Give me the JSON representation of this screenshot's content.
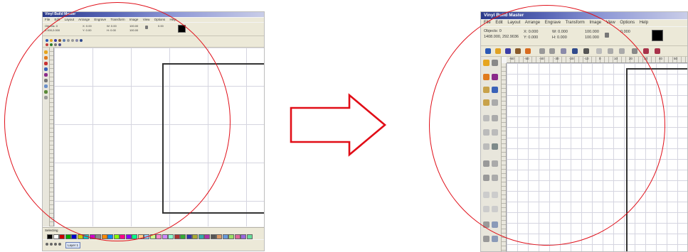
{
  "left_screen": {
    "window_title": "Vinyl Build Master",
    "menu": [
      "File",
      "Edit",
      "Layout",
      "Arrange",
      "Engrave",
      "Transform",
      "Image",
      "View",
      "Options",
      "Help"
    ],
    "prop_objects": "Objects: 0",
    "prop_coords": "0.000,0.000",
    "prop_x": "X: 0.00",
    "prop_y": "Y: 0.00",
    "prop_w": "W: 0.00",
    "prop_h": "H: 0.00",
    "prop_sw": "100.00",
    "prop_sh": "100.00",
    "prop_rot": "0.00",
    "status_text": "Selecting",
    "layer_tab": "Layer 1"
  },
  "right_screen": {
    "window_title": "Vinyl Build Master",
    "menu": [
      "File",
      "Edit",
      "Layout",
      "Arrange",
      "Engrave",
      "Transform",
      "Image",
      "View",
      "Options",
      "Help"
    ],
    "prop_objects": "Objects: 0",
    "prop_coords": "1408.000, 292.9036",
    "prop_x": "X: 0.000",
    "prop_y": "Y: 0.000",
    "prop_w": "W: 0.000",
    "prop_h": "H: 0.000",
    "prop_sw": "100.000",
    "prop_sh": "100.000",
    "prop_rot": "0.000",
    "ruler_labels": [
      "-60",
      "-50",
      "-40",
      "-30",
      "-20",
      "-10",
      "0",
      "10",
      "20",
      "30",
      "40",
      "50"
    ]
  },
  "arrow": {
    "color": "#e10d17"
  },
  "highlight": {
    "color": "#e0101a"
  }
}
